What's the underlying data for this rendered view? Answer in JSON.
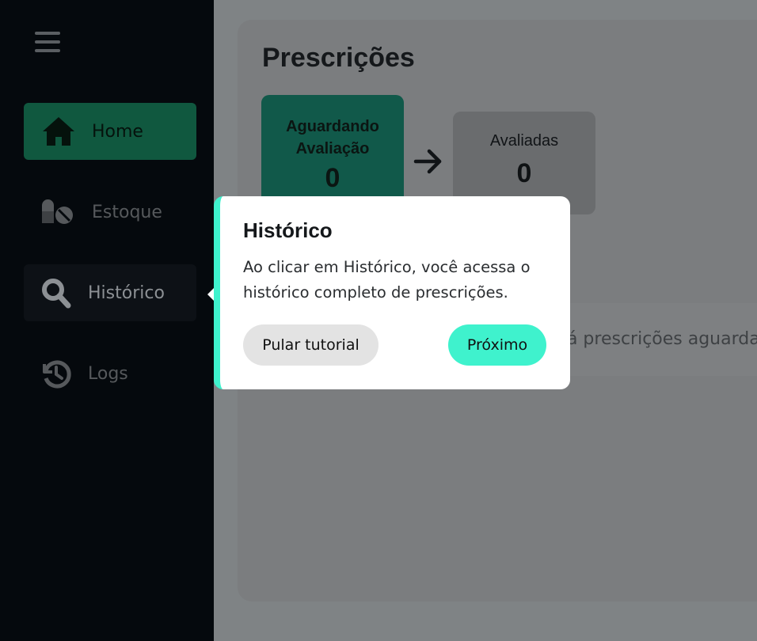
{
  "sidebar": {
    "items": [
      {
        "label": "Home",
        "icon": "home-icon"
      },
      {
        "label": "Estoque",
        "icon": "pills-icon"
      },
      {
        "label": "Histórico",
        "icon": "search-icon"
      },
      {
        "label": "Logs",
        "icon": "history-icon"
      }
    ]
  },
  "main": {
    "title": "Prescrições",
    "cards": [
      {
        "label_line1": "Aguardando",
        "label_line2": "Avaliação",
        "value": "0"
      },
      {
        "label": "Avaliadas",
        "value": "0"
      }
    ],
    "empty_message": "há prescrições aguarda"
  },
  "tooltip": {
    "title": "Histórico",
    "body": "Ao clicar em Histórico, você acessa o histórico completo de prescrições.",
    "skip_label": "Pular tutorial",
    "next_label": "Próximo"
  },
  "colors": {
    "accent": "#3ff2cd",
    "sidebar_bg": "#05090d",
    "overlay": "#7f8385"
  }
}
